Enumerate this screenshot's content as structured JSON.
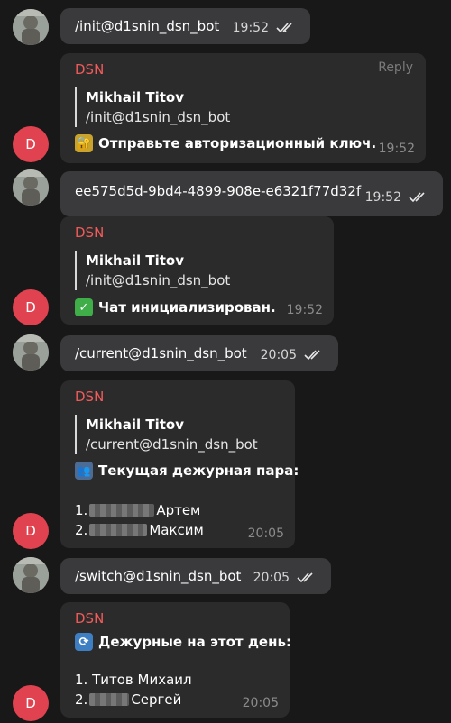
{
  "user": {
    "name": "Mikhail Titov"
  },
  "bot": {
    "name": "DSN",
    "avatar_letter": "D"
  },
  "messages": [
    {
      "type": "out",
      "text": "/init@d1snin_dsn_bot",
      "time": "19:52"
    },
    {
      "type": "in",
      "sender": "DSN",
      "reply_label": "Reply",
      "quote_name": "Mikhail Titov",
      "quote_text": "/init@d1snin_dsn_bot",
      "icon": "lock-key-emoji",
      "text": "Отправьте авторизационный ключ.",
      "time": "19:52"
    },
    {
      "type": "out",
      "text": "ee575d5d-9bd4-4899-908e-e6321f77d32f",
      "time": "19:52"
    },
    {
      "type": "in",
      "sender": "DSN",
      "quote_name": "Mikhail Titov",
      "quote_text": "/init@d1snin_dsn_bot",
      "icon": "check-mark-emoji",
      "text": "Чат инициализирован.",
      "time": "19:52"
    },
    {
      "type": "out",
      "text": "/current@d1snin_dsn_bot",
      "time": "20:05"
    },
    {
      "type": "in",
      "sender": "DSN",
      "quote_name": "Mikhail Titov",
      "quote_text": "/current@d1snin_dsn_bot",
      "icon": "people-emoji",
      "text": "Текущая дежурная пара:",
      "list": [
        "1.",
        "Артем",
        "2.",
        "Максим"
      ],
      "time": "20:05"
    },
    {
      "type": "out",
      "text": "/switch@d1snin_dsn_bot",
      "time": "20:05"
    },
    {
      "type": "in",
      "sender": "DSN",
      "icon": "refresh-emoji",
      "text": "Дежурные на этот день:",
      "list": [
        "1. Титов Михаил",
        "2.",
        "Сергей"
      ],
      "time": "20:05"
    }
  ]
}
